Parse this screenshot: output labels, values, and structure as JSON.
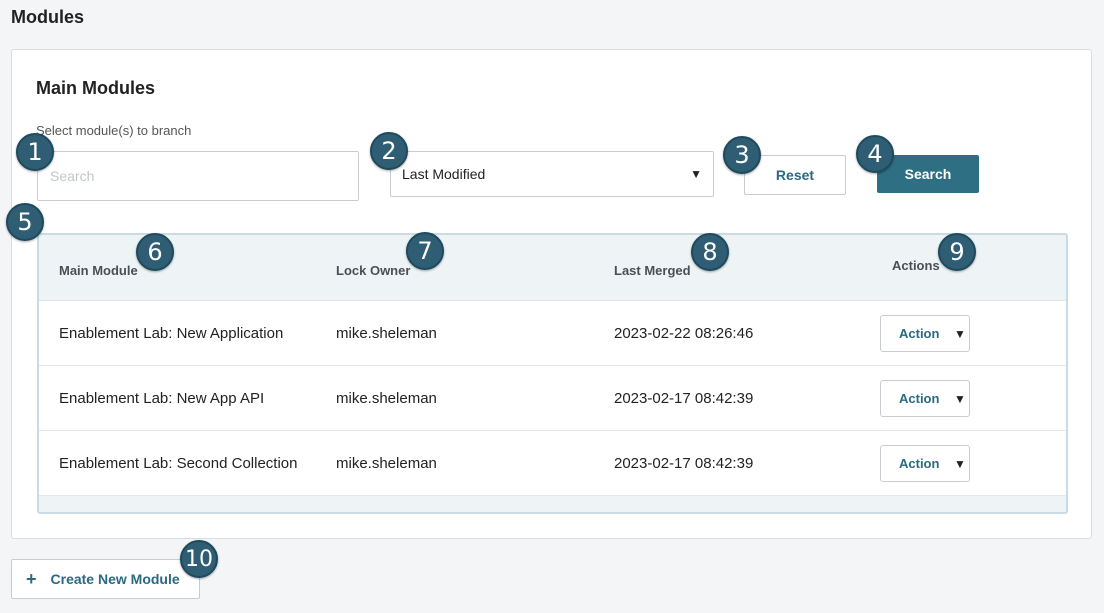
{
  "page": {
    "title": "Modules"
  },
  "panel": {
    "title": "Main Modules",
    "select_label": "Select module(s) to branch",
    "search": {
      "placeholder": "Search",
      "value": ""
    },
    "sort": {
      "value": "Last Modified"
    },
    "reset_label": "Reset",
    "search_label": "Search"
  },
  "table": {
    "headers": [
      "Main Module",
      "Lock Owner",
      "Last Merged",
      "Actions"
    ],
    "rows": [
      {
        "module": "Enablement Lab: New Application",
        "owner": "mike.sheleman",
        "merged": "2023-02-22 08:26:46",
        "action": "Action"
      },
      {
        "module": "Enablement Lab: New App API",
        "owner": "mike.sheleman",
        "merged": "2023-02-17 08:42:39",
        "action": "Action"
      },
      {
        "module": "Enablement Lab: Second Collection",
        "owner": "mike.sheleman",
        "merged": "2023-02-17 08:42:39",
        "action": "Action"
      }
    ]
  },
  "create_label": "Create New Module",
  "callouts": [
    "1",
    "2",
    "3",
    "4",
    "5",
    "6",
    "7",
    "8",
    "9",
    "10"
  ],
  "colors": {
    "accent": "#2f6f84",
    "badge": "#2e5d74",
    "header_bg": "#eef3f6"
  }
}
